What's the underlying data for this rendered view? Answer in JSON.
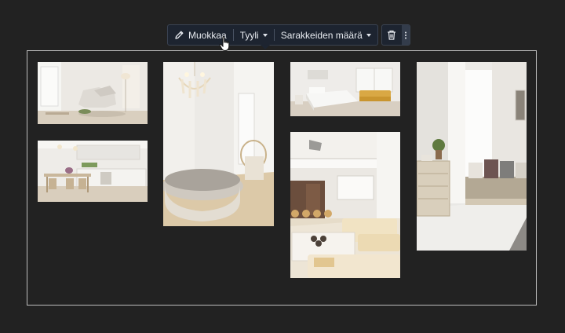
{
  "toolbar": {
    "edit_label": "Muokkaa",
    "edit_icon": "pencil-icon",
    "style_label": "Tyyli",
    "columns_label": "Sarakkeiden määrä",
    "delete_icon": "trash-icon",
    "more_icon": "more-vertical-icon"
  },
  "gallery": {
    "images": [
      {
        "name": "living-room-armchair"
      },
      {
        "name": "bright-kitchen-dining"
      },
      {
        "name": "round-sofa-chandelier-room"
      },
      {
        "name": "bedroom-yellow-sofa"
      },
      {
        "name": "loft-living-room"
      },
      {
        "name": "hallway-dresser-sofa"
      }
    ]
  },
  "colors": {
    "background": "#222222",
    "toolbar": "#1d2430",
    "frame": "#bcbcbc"
  }
}
